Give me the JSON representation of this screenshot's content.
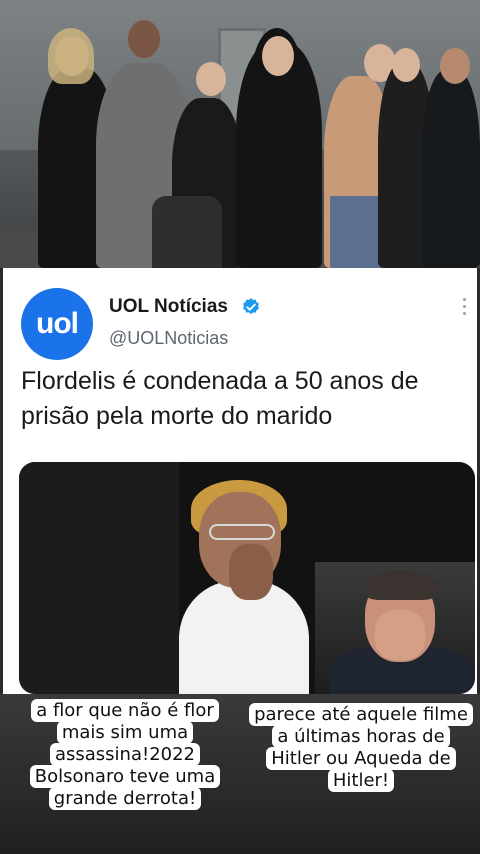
{
  "tweet": {
    "account_name": "UOL Notícias",
    "account_handle": "@UOLNoticias",
    "avatar_text": "uol",
    "text": "Flordelis é condenada a 50 anos de prisão pela morte do marido",
    "verified_icon": "verified-badge-icon",
    "more_icon": "more-vertical-icon"
  },
  "captions": {
    "left": "a flor que não é flor mais sim uma assassina!2022 Bolsonaro teve uma grande derrota!",
    "right": "parece até aquele filme a últimas horas de Hitler ou Aqueda de Hitler!"
  },
  "colors": {
    "uol_blue": "#1a73e8",
    "verified_blue": "#1d9bf0"
  }
}
